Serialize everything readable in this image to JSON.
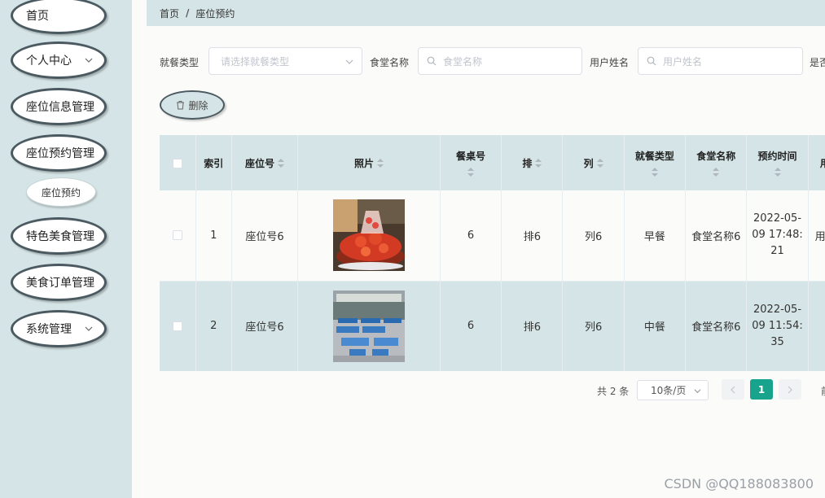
{
  "sidebar": {
    "items": [
      {
        "label": "首页"
      },
      {
        "label": "个人中心"
      },
      {
        "label": "座位信息管理"
      },
      {
        "label": "座位预约管理"
      },
      {
        "label": "座位预约"
      },
      {
        "label": "特色美食管理"
      },
      {
        "label": "美食订单管理"
      },
      {
        "label": "系统管理"
      }
    ]
  },
  "breadcrumb": {
    "home": "首页",
    "sep": "/",
    "current": "座位预约"
  },
  "filters": {
    "meal_type_label": "就餐类型",
    "meal_type_placeholder": "请选择就餐类型",
    "canteen_label": "食堂名称",
    "canteen_placeholder": "食堂名称",
    "user_label": "用户姓名",
    "user_placeholder": "用户姓名",
    "cut_label": "是否"
  },
  "toolbar": {
    "delete_label": "删除"
  },
  "table": {
    "headers": {
      "index": "索引",
      "seat_no": "座位号",
      "photo": "照片",
      "table_no": "餐桌号",
      "row": "排",
      "col": "列",
      "meal_type": "就餐类型",
      "canteen": "食堂名称",
      "time": "预约时间",
      "user": "用户"
    },
    "rows": [
      {
        "index": "1",
        "seat_no": "座位号6",
        "photo": "strawberry-dessert",
        "table_no": "6",
        "row": "排6",
        "col": "列6",
        "meal_type": "早餐",
        "canteen": "食堂名称6",
        "time_date": "2022-05-",
        "time_hm": "09 17:48:",
        "time_s": "21",
        "user": "用户"
      },
      {
        "index": "2",
        "seat_no": "座位号6",
        "photo": "canteen-hall",
        "table_no": "6",
        "row": "排6",
        "col": "列6",
        "meal_type": "中餐",
        "canteen": "食堂名称6",
        "time_date": "2022-05-",
        "time_hm": "09 11:54:",
        "time_s": "35",
        "user": ""
      }
    ]
  },
  "pagination": {
    "total": "共 2 条",
    "page_size": "10条/页",
    "current_page": "1",
    "cut": "前"
  },
  "watermark": "CSDN @QQ188083800",
  "colors": {
    "accent": "#17a38c",
    "panel": "#d5e4e6"
  }
}
